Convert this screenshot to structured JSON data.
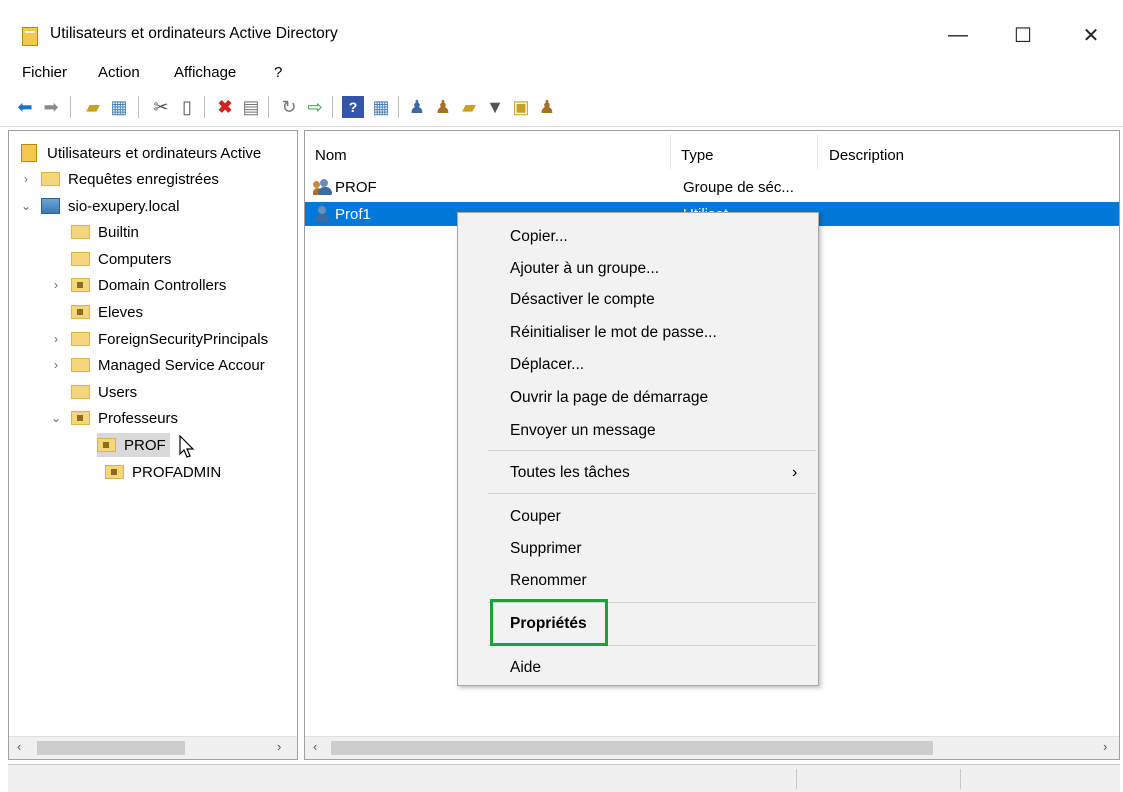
{
  "window": {
    "title": "Utilisateurs et ordinateurs Active Directory",
    "minimize": "—",
    "maximize": "☐",
    "close": "✕"
  },
  "menu": [
    "Fichier",
    "Action",
    "Affichage",
    "?"
  ],
  "toolbar": {
    "icons": [
      "back-arrow-icon",
      "forward-arrow-icon",
      "up-folder-icon",
      "show-console-tree-icon",
      "cut-icon",
      "paste-icon",
      "delete-icon",
      "properties-icon",
      "refresh-icon",
      "export-list-icon",
      "help-icon",
      "show-action-pane-icon",
      "new-user-icon",
      "new-group-icon",
      "new-ou-icon",
      "filter-icon",
      "find-icon",
      "add-to-group-icon"
    ]
  },
  "tree": {
    "root": "Utilisateurs et ordinateurs Active",
    "saved_queries": "Requêtes enregistrées",
    "domain": "sio-exupery.local",
    "items": [
      "Builtin",
      "Computers",
      "Domain Controllers",
      "Eleves",
      "ForeignSecurityPrincipals",
      "Managed Service Accour",
      "Users",
      "Professeurs"
    ],
    "children": [
      "PROF",
      "PROFADMIN"
    ]
  },
  "list": {
    "columns": {
      "name": "Nom",
      "type": "Type",
      "description": "Description"
    },
    "rows": [
      {
        "name": "PROF",
        "type": "Groupe de séc...",
        "icon": "group-icon"
      },
      {
        "name": "Prof1",
        "type": "Utilisat...",
        "icon": "user-icon"
      }
    ]
  },
  "context_menu": {
    "items": [
      "Copier...",
      "Ajouter à un groupe...",
      "Désactiver le compte",
      "Réinitialiser le mot de passe...",
      "Déplacer...",
      "Ouvrir la page de démarrage",
      "Envoyer un message",
      "Toutes les tâches",
      "Couper",
      "Supprimer",
      "Renommer",
      "Propriétés",
      "Aide"
    ],
    "submenu_arrow": "›",
    "highlight_color": "#16a33a"
  },
  "colors": {
    "selection": "#0078d7",
    "selection_text": "#ffffff"
  }
}
